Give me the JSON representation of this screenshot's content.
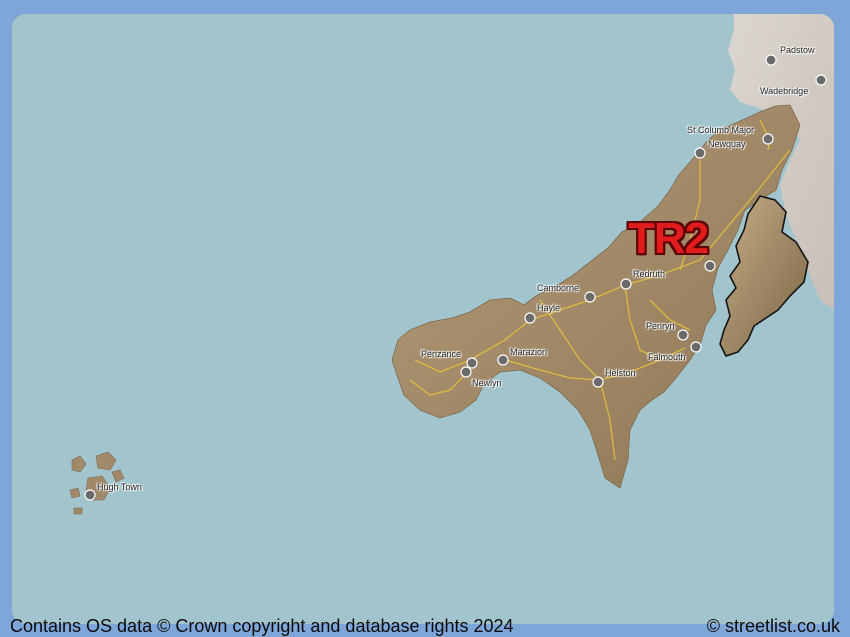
{
  "map": {
    "district_code": "TR2",
    "towns": [
      {
        "key": "padstow",
        "name": "Padstow"
      },
      {
        "key": "wadebridge",
        "name": "Wadebridge"
      },
      {
        "key": "st_columb_major",
        "name": "St Columb Major"
      },
      {
        "key": "newquay",
        "name": "Newquay"
      },
      {
        "key": "redruth",
        "name": "Redruth"
      },
      {
        "key": "camborne",
        "name": "Camborne"
      },
      {
        "key": "hayle",
        "name": "Hayle"
      },
      {
        "key": "penryn",
        "name": "Penryn"
      },
      {
        "key": "penzance",
        "name": "Penzance"
      },
      {
        "key": "marazion",
        "name": "Marazion"
      },
      {
        "key": "falmouth",
        "name": "Falmouth"
      },
      {
        "key": "newlyn",
        "name": "Newlyn"
      },
      {
        "key": "helston",
        "name": "Helston"
      },
      {
        "key": "hugh_town",
        "name": "Hugh Town"
      }
    ],
    "colors": {
      "sea": "#a2c4cd",
      "land": "#a08a6a",
      "highlight": "#e21b1b",
      "roads": "#e8c23a",
      "frame": "#7fa6d8"
    }
  },
  "footer": {
    "attribution": "Contains OS data © Crown copyright and database rights 2024",
    "brand": "© streetlist.co.uk"
  }
}
